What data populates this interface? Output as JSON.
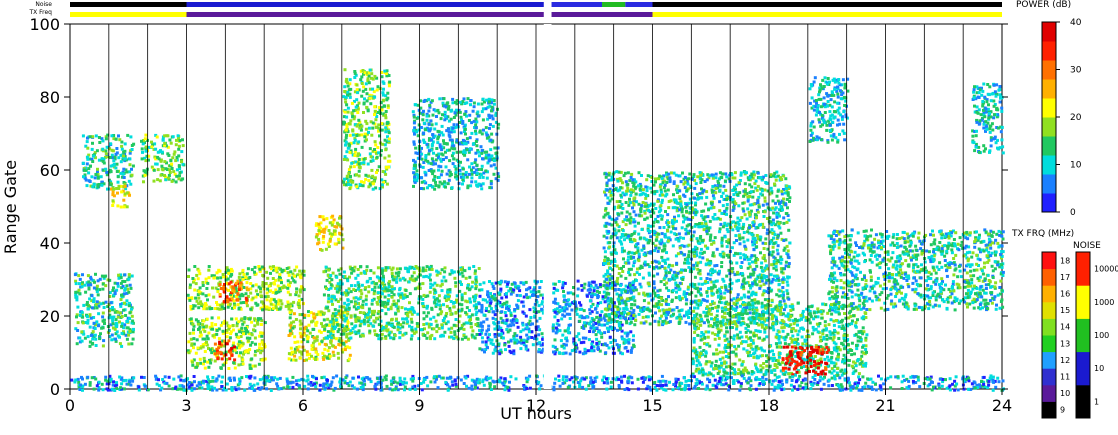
{
  "header": {
    "noise_label": "Noise",
    "txfreq_label": "TX Freq",
    "noise_segments": [
      {
        "start": 0,
        "end": 3,
        "color": "#000000"
      },
      {
        "start": 3,
        "end": 12.2,
        "color": "#1a1ad0"
      },
      {
        "start": 12.4,
        "end": 13.7,
        "color": "#2b2be0"
      },
      {
        "start": 13.7,
        "end": 14.3,
        "color": "#22bb22"
      },
      {
        "start": 14.3,
        "end": 15,
        "color": "#2b2be0"
      },
      {
        "start": 15,
        "end": 24,
        "color": "#000000"
      }
    ],
    "txfreq_segments": [
      {
        "start": 0,
        "end": 3,
        "color": "#ffff00"
      },
      {
        "start": 3,
        "end": 12.2,
        "color": "#5a1a9a"
      },
      {
        "start": 12.4,
        "end": 15,
        "color": "#5a1a9a"
      },
      {
        "start": 15,
        "end": 24,
        "color": "#ffff00"
      }
    ]
  },
  "chart_data": {
    "type": "heatmap",
    "title": "",
    "xlabel": "UT hours",
    "ylabel": "Range Gate",
    "xlim": [
      0,
      24
    ],
    "ylim": [
      0,
      100
    ],
    "x_ticks": [
      "0",
      "3",
      "6",
      "9",
      "12",
      "15",
      "18",
      "21",
      "24"
    ],
    "y_ticks": [
      "0",
      "20",
      "40",
      "60",
      "80",
      "100"
    ],
    "scan_boundaries_hours": [
      1,
      2,
      3,
      4,
      5,
      6,
      7,
      8,
      9,
      10,
      11,
      12,
      13,
      14,
      15,
      16,
      17,
      18,
      19,
      20,
      21,
      22,
      23
    ],
    "data_gap_hours": [
      12.2,
      12.4
    ],
    "power_regions": [
      {
        "x0": 0.1,
        "x1": 1.6,
        "y0": 12,
        "y1": 32,
        "power": 12
      },
      {
        "x0": 0.3,
        "x1": 1.6,
        "y0": 55,
        "y1": 70,
        "power": 12
      },
      {
        "x0": 1.0,
        "x1": 1.5,
        "y0": 50,
        "y1": 56,
        "power": 22
      },
      {
        "x0": 1.8,
        "x1": 2.9,
        "y0": 57,
        "y1": 70,
        "power": 16
      },
      {
        "x0": 3.0,
        "x1": 6.0,
        "y0": 22,
        "y1": 34,
        "power": 18
      },
      {
        "x0": 3.8,
        "x1": 4.6,
        "y0": 24,
        "y1": 30,
        "power": 30
      },
      {
        "x0": 3.0,
        "x1": 5.0,
        "y0": 6,
        "y1": 20,
        "power": 18
      },
      {
        "x0": 3.7,
        "x1": 4.2,
        "y0": 8,
        "y1": 14,
        "power": 32
      },
      {
        "x0": 5.6,
        "x1": 7.2,
        "y0": 8,
        "y1": 22,
        "power": 20
      },
      {
        "x0": 6.3,
        "x1": 7.0,
        "y0": 38,
        "y1": 48,
        "power": 22
      },
      {
        "x0": 7.0,
        "x1": 8.2,
        "y0": 55,
        "y1": 88,
        "power": 16
      },
      {
        "x0": 6.5,
        "x1": 10.5,
        "y0": 14,
        "y1": 34,
        "power": 14
      },
      {
        "x0": 8.8,
        "x1": 11.0,
        "y0": 55,
        "y1": 80,
        "power": 10
      },
      {
        "x0": 10.5,
        "x1": 12.2,
        "y0": 10,
        "y1": 30,
        "power": 8
      },
      {
        "x0": 12.4,
        "x1": 14.5,
        "y0": 10,
        "y1": 30,
        "power": 8
      },
      {
        "x0": 13.7,
        "x1": 18.5,
        "y0": 18,
        "y1": 60,
        "power": 12
      },
      {
        "x0": 16.0,
        "x1": 20.5,
        "y0": 4,
        "y1": 24,
        "power": 14
      },
      {
        "x0": 18.3,
        "x1": 19.5,
        "y0": 4,
        "y1": 12,
        "power": 36
      },
      {
        "x0": 19.5,
        "x1": 24.0,
        "y0": 22,
        "y1": 44,
        "power": 12
      },
      {
        "x0": 19.0,
        "x1": 20.0,
        "y0": 68,
        "y1": 86,
        "power": 10
      },
      {
        "x0": 23.2,
        "x1": 24.0,
        "y0": 65,
        "y1": 84,
        "power": 10
      },
      {
        "x0": 0.0,
        "x1": 24.0,
        "y0": 0,
        "y1": 4,
        "power": 8
      }
    ],
    "power_scale": {
      "label": "POWER (dB)",
      "min": 0,
      "max": 40,
      "ticks": [
        "0",
        "10",
        "20",
        "30",
        "40"
      ]
    },
    "txfreq_scale": {
      "label": "TX FRQ (MHz)",
      "ticks": [
        "9",
        "10",
        "11",
        "12",
        "13",
        "14",
        "15",
        "16",
        "17",
        "18"
      ]
    },
    "noise_scale": {
      "label": "NOISE",
      "ticks": [
        "1",
        "10",
        "100",
        "1000",
        "10000"
      ]
    }
  },
  "colors": {
    "power_scale": [
      "#2020ff",
      "#1a80ff",
      "#00dddd",
      "#20c860",
      "#90e020",
      "#ffff00",
      "#ffb000",
      "#ff7000",
      "#ff2000",
      "#e00000"
    ],
    "txfreq_steps": [
      "#000000",
      "#5a1a9a",
      "#3030d0",
      "#20a0ff",
      "#20d020",
      "#80e020",
      "#e0e000",
      "#ffb000",
      "#ff6000",
      "#ff1010"
    ],
    "noise_steps": [
      "#000000",
      "#1a1ad0",
      "#20c020",
      "#ffff00",
      "#ff2000"
    ]
  }
}
